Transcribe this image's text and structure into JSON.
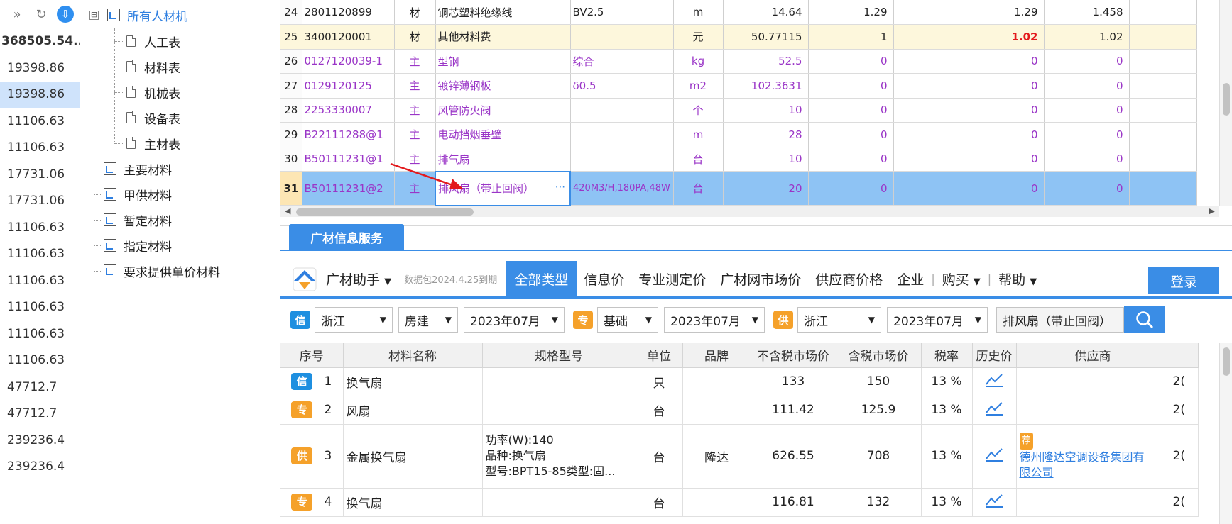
{
  "left_values": {
    "items": [
      {
        "v": "368505.54...",
        "bold": true
      },
      {
        "v": "19398.86"
      },
      {
        "v": "19398.86",
        "selected": true
      },
      {
        "v": "11106.63"
      },
      {
        "v": "11106.63"
      },
      {
        "v": "17731.06"
      },
      {
        "v": "17731.06"
      },
      {
        "v": "11106.63"
      },
      {
        "v": "11106.63"
      },
      {
        "v": "11106.63"
      },
      {
        "v": "11106.63"
      },
      {
        "v": "11106.63"
      },
      {
        "v": "11106.63"
      },
      {
        "v": "47712.7"
      },
      {
        "v": "47712.7"
      },
      {
        "v": "239236.4"
      },
      {
        "v": "239236.4"
      }
    ],
    "top_icons": [
      "double-chevron-right-icon",
      "refresh-icon",
      "download-icon"
    ]
  },
  "tree": {
    "root": "所有人材机",
    "root_toggle": "⊟",
    "children": [
      "人工表",
      "材料表",
      "机械表",
      "设备表",
      "主材表"
    ],
    "siblings": [
      "主要材料",
      "甲供材料",
      "暂定材料",
      "指定材料",
      "要求提供单价材料"
    ]
  },
  "grid": {
    "rows": [
      {
        "no": "24",
        "code": "2801120899",
        "type": "材",
        "name": "铜芯塑料绝缘线",
        "spec": "BV2.5",
        "unit": "m",
        "qty": "14.64",
        "c1": "1.29",
        "c2": "1.29",
        "c3": "1.458",
        "style": "normal"
      },
      {
        "no": "25",
        "code": "3400120001",
        "type": "材",
        "name": "其他材料费",
        "spec": "",
        "unit": "元",
        "qty": "50.77115",
        "c1": "1",
        "c2": "1.02",
        "c3": "1.02",
        "style": "yellow"
      },
      {
        "no": "26",
        "code": "0127120039-1",
        "type": "主",
        "name": "型钢",
        "spec": "综合",
        "unit": "kg",
        "qty": "52.5",
        "c1": "0",
        "c2": "0",
        "c3": "0",
        "style": "purple"
      },
      {
        "no": "27",
        "code": "0129120125",
        "type": "主",
        "name": "镀锌薄钢板",
        "spec": "δ0.5",
        "unit": "m2",
        "qty": "102.3631",
        "c1": "0",
        "c2": "0",
        "c3": "0",
        "style": "purple"
      },
      {
        "no": "28",
        "code": "2253330007",
        "type": "主",
        "name": "风管防火阀",
        "spec": "",
        "unit": "个",
        "qty": "10",
        "c1": "0",
        "c2": "0",
        "c3": "0",
        "style": "purple"
      },
      {
        "no": "29",
        "code": "B22111288@1",
        "type": "主",
        "name": "电动挡烟垂壁",
        "spec": "",
        "unit": "m",
        "qty": "28",
        "c1": "0",
        "c2": "0",
        "c3": "0",
        "style": "purple"
      },
      {
        "no": "30",
        "code": "B50111231@1",
        "type": "主",
        "name": "排气扇",
        "spec": "",
        "unit": "台",
        "qty": "10",
        "c1": "0",
        "c2": "0",
        "c3": "0",
        "style": "purple"
      },
      {
        "no": "31",
        "code": "B50111231@2",
        "type": "主",
        "name": "排风扇（带止回阀）",
        "spec": "420M3/H,180PA,48W",
        "unit": "台",
        "qty": "20",
        "c1": "0",
        "c2": "0",
        "c3": "0",
        "style": "selected"
      }
    ],
    "edit_ellipsis": "···"
  },
  "panel": {
    "tab": "广材信息服务",
    "assistant": "广材助手",
    "assistant_arrow": "▼",
    "data_pack": "数据包2024.4.25到期",
    "tabs": [
      "全部类型",
      "信息价",
      "专业测定价",
      "广材网市场价",
      "供应商价格",
      "企业"
    ],
    "buy": "购买",
    "help": "帮助",
    "login": "登录",
    "filters": {
      "xin_badge": "信",
      "province1": "浙江",
      "category": "房建",
      "date1": "2023年07月",
      "zhuan_badge": "专",
      "base": "基础",
      "date2": "2023年07月",
      "gong_badge": "供",
      "province2": "浙江",
      "date3": "2023年07月",
      "search_value": "排风扇（带止回阀）"
    },
    "columns": [
      "序号",
      "材料名称",
      "规格型号",
      "单位",
      "品牌",
      "不含税市场价",
      "含税市场价",
      "税率",
      "历史价",
      "供应商",
      ""
    ],
    "results": [
      {
        "badge": "信",
        "badge_type": "xin",
        "no": "1",
        "name": "换气扇",
        "spec": [],
        "unit": "只",
        "brand": "",
        "price_ex": "133",
        "price_in": "150",
        "tax": "13 %",
        "supplier": [],
        "last": "2("
      },
      {
        "badge": "专",
        "badge_type": "zhuan",
        "no": "2",
        "name": "风扇",
        "spec": [],
        "unit": "台",
        "brand": "",
        "price_ex": "111.42",
        "price_in": "125.9",
        "tax": "13 %",
        "supplier": [],
        "last": "2("
      },
      {
        "badge": "供",
        "badge_type": "gong",
        "no": "3",
        "name": "金属换气扇",
        "spec": [
          "功率(W):140",
          "品种:换气扇",
          "型号:BPT15-85类型:固..."
        ],
        "unit": "台",
        "brand": "隆达",
        "price_ex": "626.55",
        "price_in": "708",
        "tax": "13 %",
        "supplier_tag": "荐",
        "supplier": [
          "德州隆达空调设备集团有",
          "限公司"
        ],
        "last": "2("
      },
      {
        "badge": "专",
        "badge_type": "zhuan",
        "no": "4",
        "name": "换气扇",
        "spec": [],
        "unit": "台",
        "brand": "",
        "price_ex": "116.81",
        "price_in": "132",
        "tax": "13 %",
        "supplier": [],
        "last": "2("
      }
    ]
  },
  "colors": {
    "accent": "#3a8de6",
    "purple": "#9a35c7",
    "selected_row": "#8ec3f4",
    "yellow_row": "#fdf7dc",
    "red": "#e3191c"
  }
}
